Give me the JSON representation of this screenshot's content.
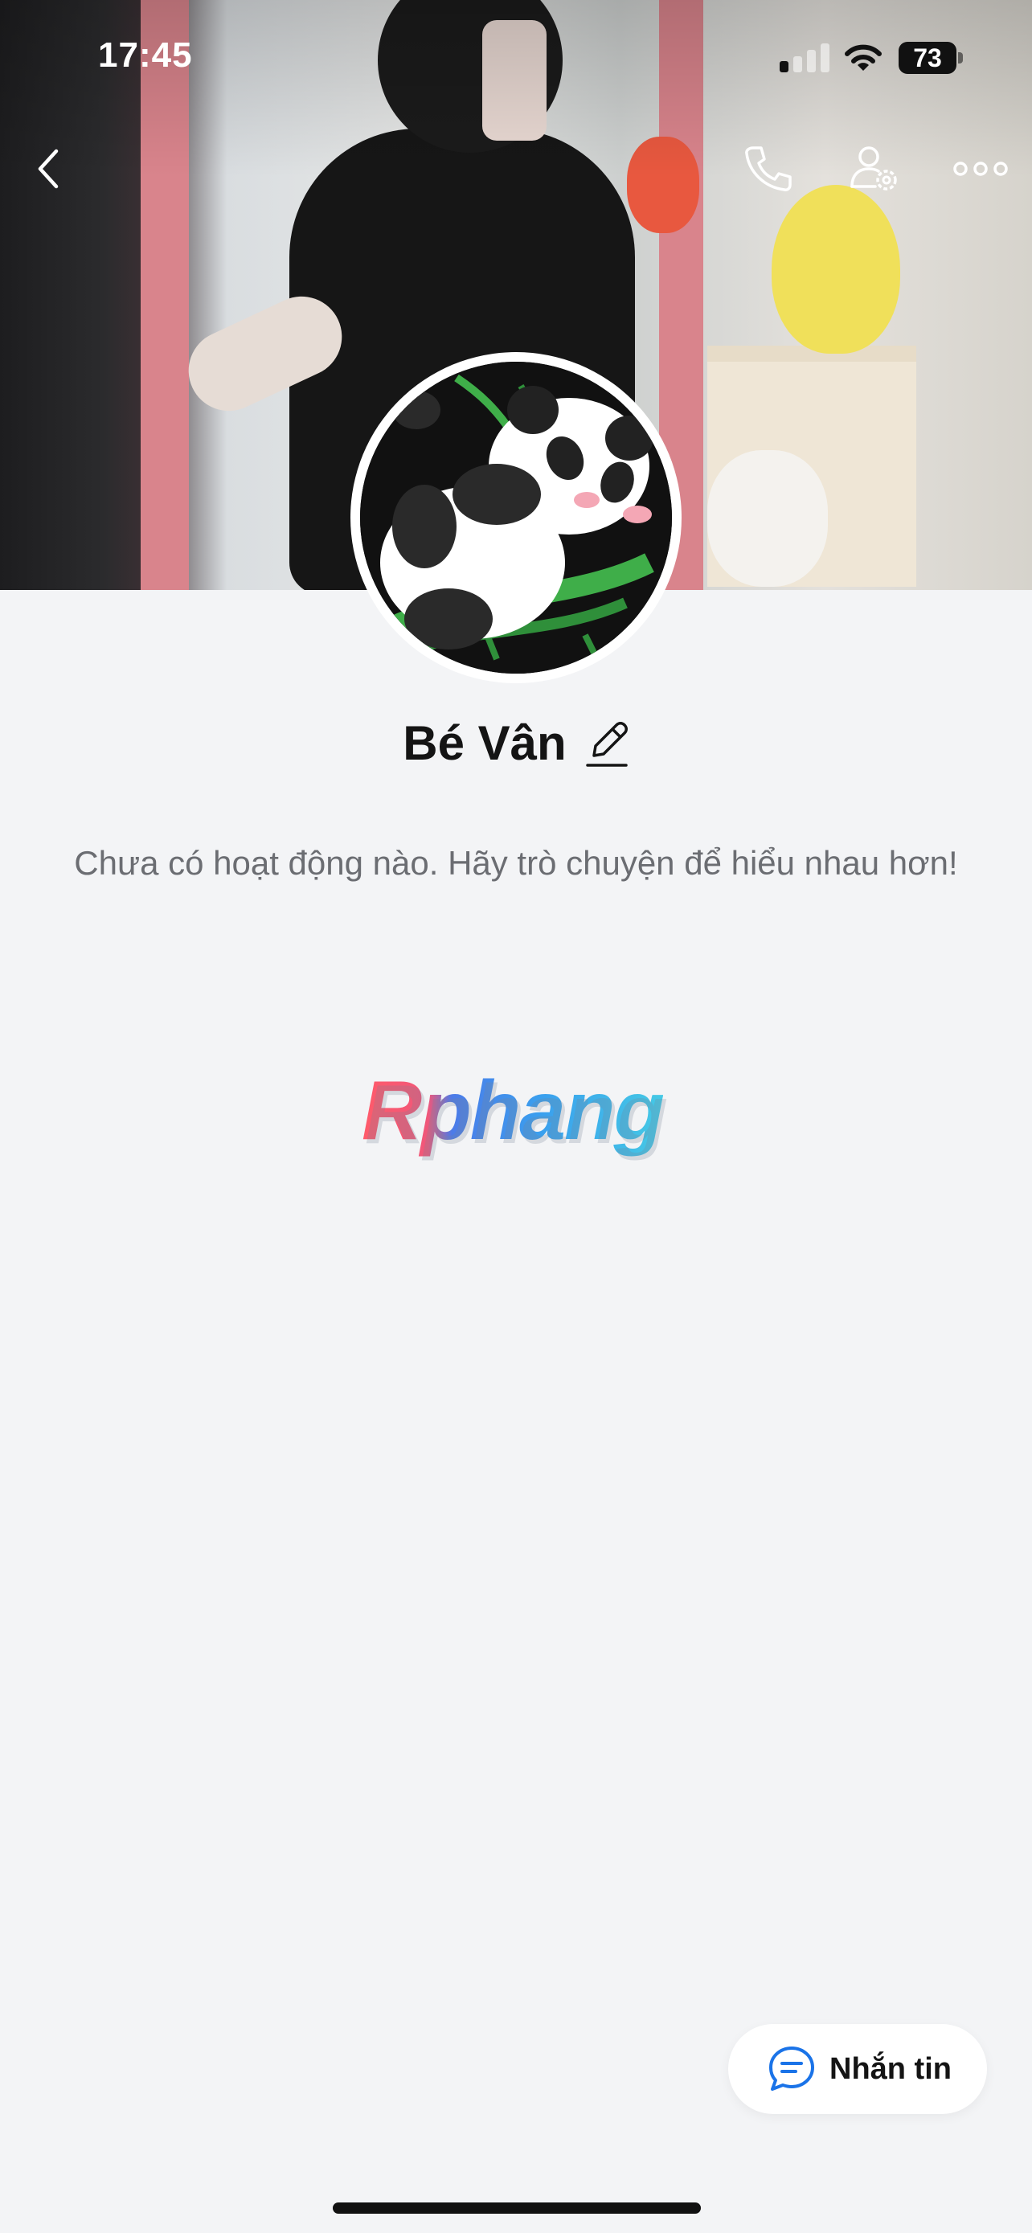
{
  "status_bar": {
    "time": "17:45",
    "battery_level": "73",
    "signal_icon": "cellular-signal-icon",
    "wifi_icon": "wifi-icon"
  },
  "nav": {
    "back_icon": "chevron-left-icon",
    "call_icon": "phone-icon",
    "settings_icon": "user-settings-icon",
    "more_icon": "more-horizontal-icon"
  },
  "profile": {
    "name": "Bé Vân",
    "edit_icon": "pencil-icon",
    "empty_message": "Chưa có hoạt động nào. Hãy trò chuyện để hiểu nhau hơn!"
  },
  "watermark": {
    "text": "Rphang"
  },
  "actions": {
    "message_label": "Nhắn tin",
    "message_icon": "chat-bubble-icon",
    "accent_color": "#1a73e8"
  }
}
